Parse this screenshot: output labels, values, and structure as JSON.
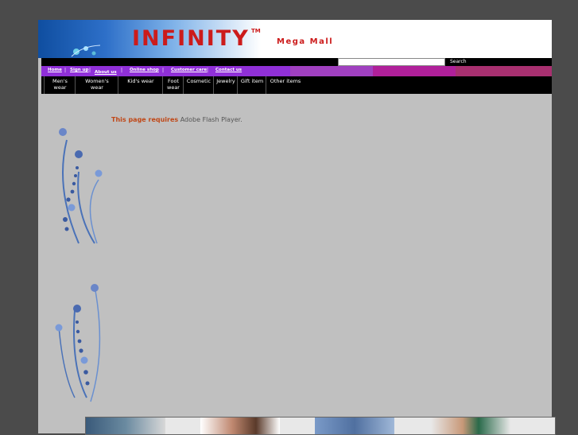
{
  "brand": {
    "logo_text": "INFINITY",
    "tm": "TM",
    "tagline": "Mega Mall"
  },
  "colors": {
    "logo_red": "#cc1b1b",
    "nav_purple": "#9030d8",
    "page_bg": "#c0c0c0",
    "outer_bg": "#4b4b4b"
  },
  "search": {
    "value": "",
    "placeholder": "",
    "button_label": "Search"
  },
  "toplinks": [
    "Home",
    "Sign up",
    "About us",
    "Online shop",
    "Customer care",
    "Contact us"
  ],
  "categories": [
    {
      "line1": "Men's",
      "line2": "wear"
    },
    {
      "line1": "Women's",
      "line2": "wear"
    },
    {
      "line1": "Kid's wear",
      "line2": ""
    },
    {
      "line1": "Foot",
      "line2": "wear"
    },
    {
      "line1": "Cosmetic",
      "line2": ""
    },
    {
      "line1": "Jewelry",
      "line2": ""
    },
    {
      "line1": "Gift item",
      "line2": ""
    },
    {
      "line1": "Other items",
      "line2": ""
    }
  ],
  "flash": {
    "requires": "This page requires",
    "player": "Adobe Flash Player."
  },
  "icons": {
    "flower": "flower-ornament-icon"
  }
}
